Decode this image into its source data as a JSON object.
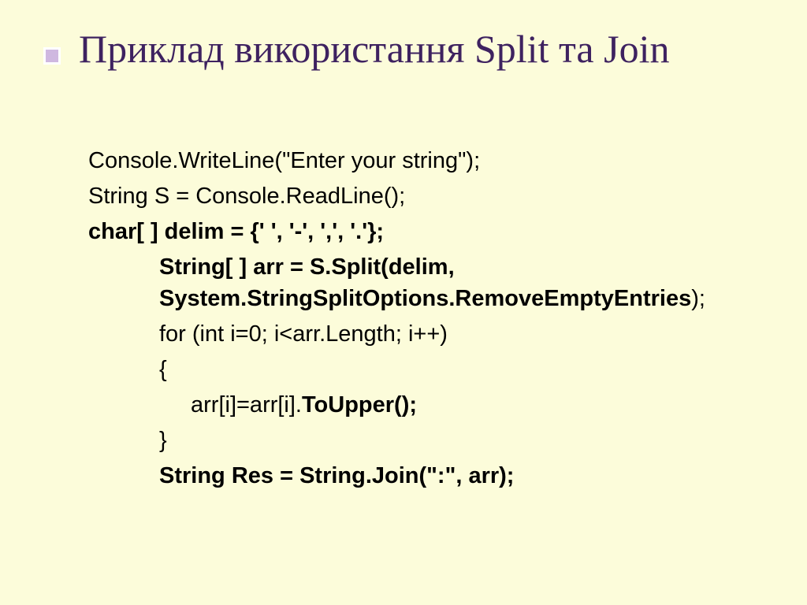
{
  "slide": {
    "title": "Приклад використання Split та Join",
    "lines": {
      "l1": "Console.WriteLine(\"Enter your string\");",
      "l2": "String S = Console.ReadLine();",
      "l3": "char[ ] delim = {' ', '-', ',', '.'};",
      "l4a": "String[ ] arr = S.Split(delim, System.StringSplitOptions.RemoveEmptyEntries",
      "l4b": ");",
      "l5": "for (int i=0; i<arr.Length; i++)",
      "l6": "{",
      "l7a": "arr[i]=arr[i].",
      "l7b": "ToUpper();",
      "l8": "}",
      "l9": "String Res = String.Join(\":\", arr);"
    }
  }
}
